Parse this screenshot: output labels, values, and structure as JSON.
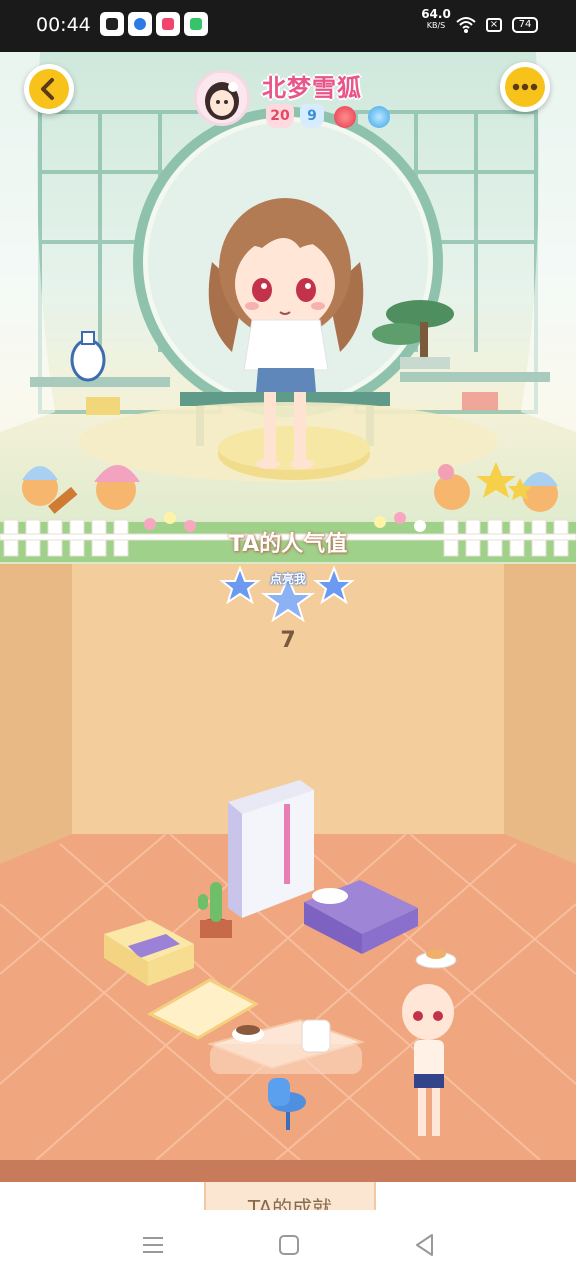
{
  "status_bar": {
    "time": "00:44",
    "net_speed": "64.0",
    "net_unit": "KB/S",
    "battery": "74",
    "sim_icon": "x-box-icon"
  },
  "profile": {
    "username": "北梦雪狐",
    "badge_level_red": "20",
    "badge_level_blue": "9"
  },
  "popularity": {
    "title": "TA的人气值",
    "like_label": "点亮我",
    "count": "7"
  },
  "achievements": {
    "tab_label": "TA的成就"
  },
  "colors": {
    "accent_yellow": "#f7c21a",
    "name_pink": "#e8558a",
    "room_wall": "#efc592",
    "room_floor": "#f0a67e"
  }
}
